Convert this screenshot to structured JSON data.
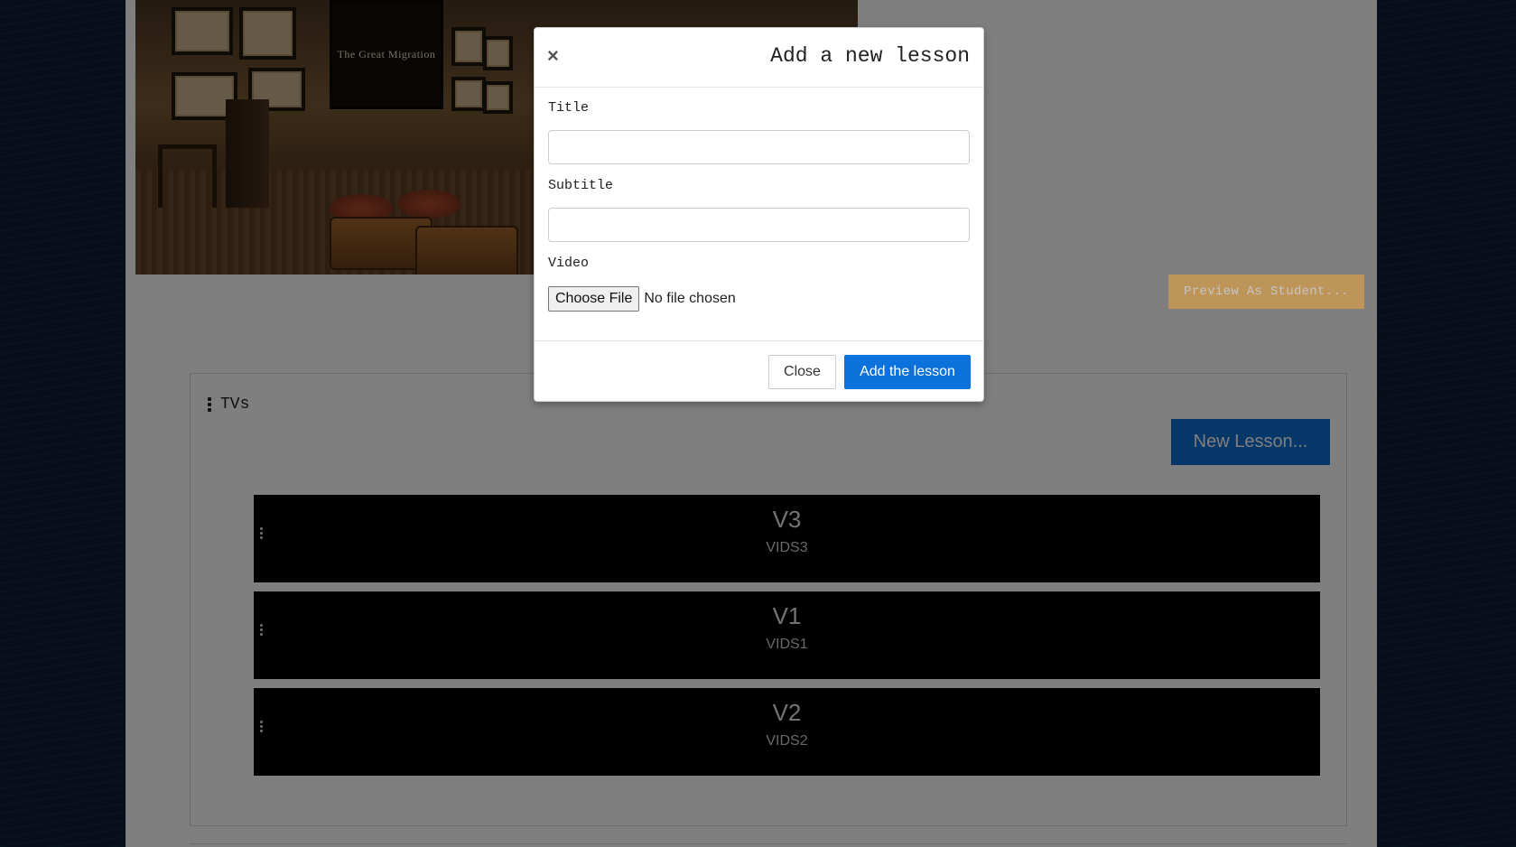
{
  "hero": {
    "screen_text": "The Great Migration"
  },
  "toolbar": {
    "preview_label": "Preview As Student..."
  },
  "section": {
    "title": "TVs",
    "new_lesson_label": "New Lesson...",
    "lessons": [
      {
        "title": "V3",
        "subtitle": "VIDS3"
      },
      {
        "title": "V1",
        "subtitle": "VIDS1"
      },
      {
        "title": "V2",
        "subtitle": "VIDS2"
      }
    ]
  },
  "modal": {
    "close_symbol": "×",
    "title": "Add a new lesson",
    "fields": {
      "title_label": "Title",
      "title_value": "",
      "subtitle_label": "Subtitle",
      "subtitle_value": "",
      "video_label": "Video",
      "choose_file_label": "Choose File",
      "file_status": "No file chosen"
    },
    "footer": {
      "close_label": "Close",
      "add_label": "Add the lesson"
    }
  },
  "colors": {
    "primary_blue": "#0b72db",
    "preview_orange": "#f0a73b",
    "lesson_bg": "#000000"
  },
  "icons": {
    "modal_close": "close-icon",
    "drag_handle": "kebab-vertical-icon"
  }
}
